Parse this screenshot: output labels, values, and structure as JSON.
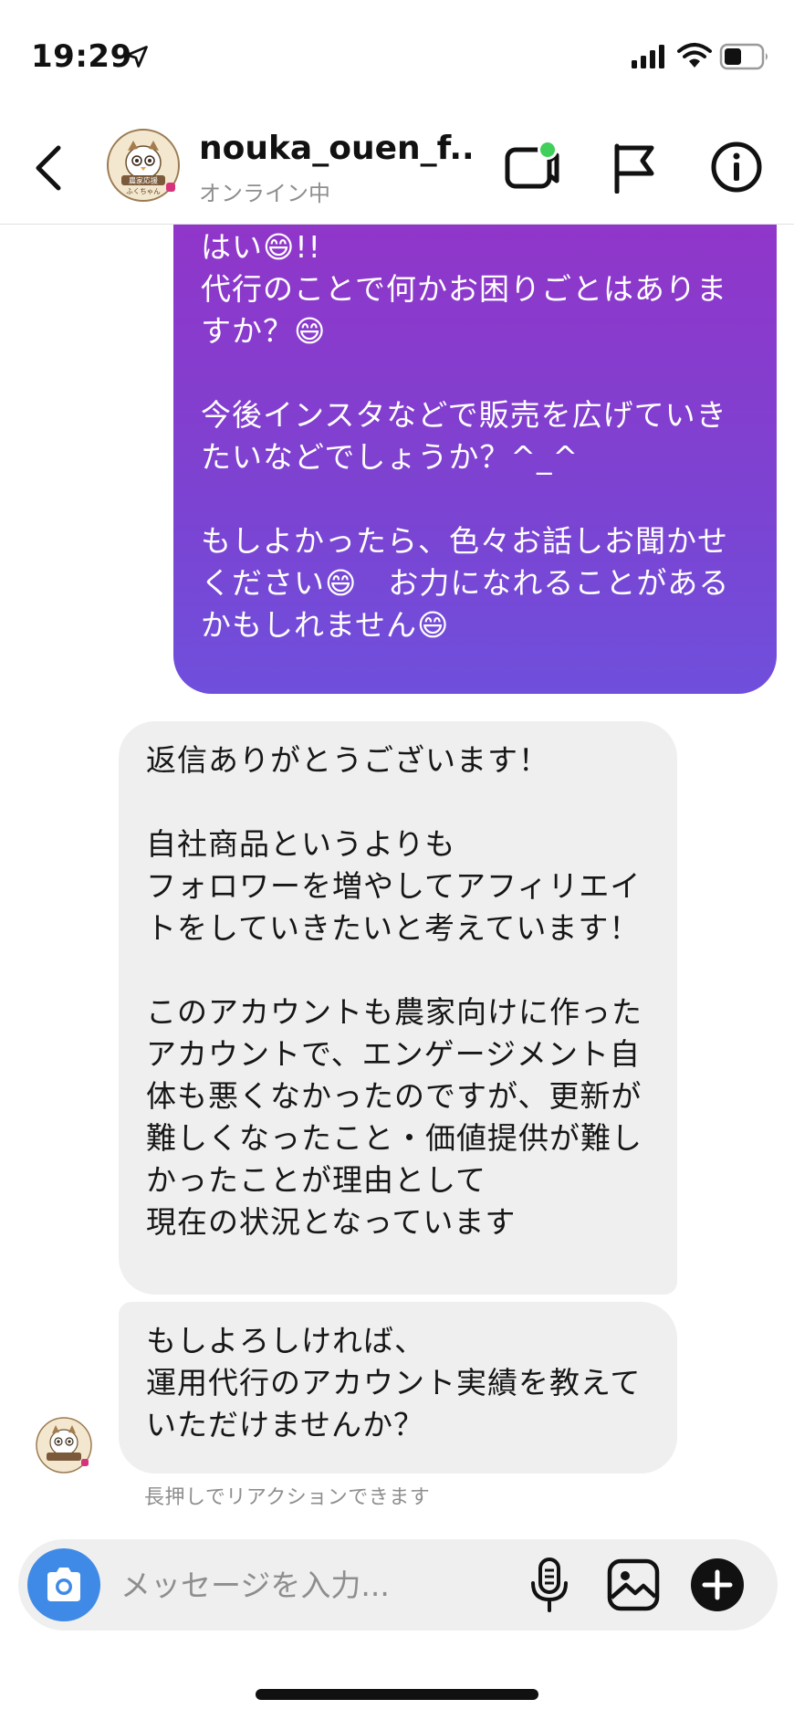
{
  "status_bar": {
    "time": "19:29",
    "icons": [
      "location-arrow-icon",
      "cellular-signal-icon",
      "wifi-icon",
      "battery-icon"
    ]
  },
  "header": {
    "username": "nouka_ouen_f...",
    "status": "オンライン中",
    "avatar_label_top": "農家応援",
    "avatar_label_bottom": "ふくちゃん",
    "online_dot_color": "#3fcf5a",
    "icons": [
      "back-chevron-icon",
      "video-call-icon",
      "flag-icon",
      "info-icon"
    ]
  },
  "messages": [
    {
      "direction": "sent",
      "text": "はい😄!!\n代行のことで何かお困りごとはありますか？😄\n\n今後インスタなどで販売を広げていきたいなどでしょうか？^_^\n\nもしよかったら、色々お話しお聞かせください😄　お力になれることがあるかもしれません😄"
    },
    {
      "direction": "received",
      "text": "返信ありがとうございます！\n\n自社商品というよりも\nフォロワーを増やしてアフィリエイトをしていきたいと考えています！\n\nこのアカウントも農家向けに作ったアカウントで、エンゲージメント自体も悪くなかったのですが、更新が難しくなったこと・価値提供が難しかったことが理由として\n現在の状況となっています"
    },
    {
      "direction": "received",
      "text": "もしよろしければ、\n運用代行のアカウント実績を教えていただけませんか？"
    }
  ],
  "reaction_hint": "長押しでリアクションできます",
  "composer": {
    "placeholder": "メッセージを入力...",
    "value": "",
    "icons": [
      "camera-icon",
      "microphone-icon",
      "gallery-icon",
      "plus-icon"
    ]
  },
  "colors": {
    "sent_bubble_top": "#9036c9",
    "sent_bubble_bottom": "#6f4fdc",
    "received_bubble": "#efefef",
    "camera_button": "#3f8ae6"
  }
}
